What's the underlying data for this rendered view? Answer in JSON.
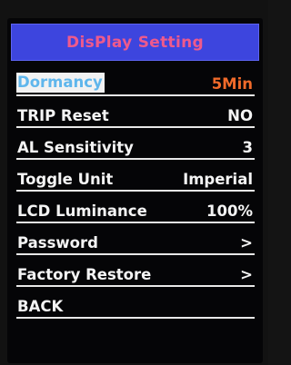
{
  "header": {
    "title": "DisPlay Setting"
  },
  "menu": {
    "items": [
      {
        "label": "Dormancy",
        "value": "5Min"
      },
      {
        "label": "TRIP Reset",
        "value": "NO"
      },
      {
        "label": "AL Sensitivity",
        "value": "3"
      },
      {
        "label": "Toggle Unit",
        "value": "Imperial"
      },
      {
        "label": "LCD Luminance",
        "value": "100%"
      },
      {
        "label": "Password",
        "value": ">"
      },
      {
        "label": "Factory Restore",
        "value": ">"
      },
      {
        "label": "BACK"
      }
    ]
  },
  "colors": {
    "title_bar": "#3d45de",
    "title_text": "#ee5a8c",
    "selected_value": "#f06a2a",
    "selected_label_text": "#5fb6ec",
    "selected_label_bg": "#f2f2f2"
  }
}
